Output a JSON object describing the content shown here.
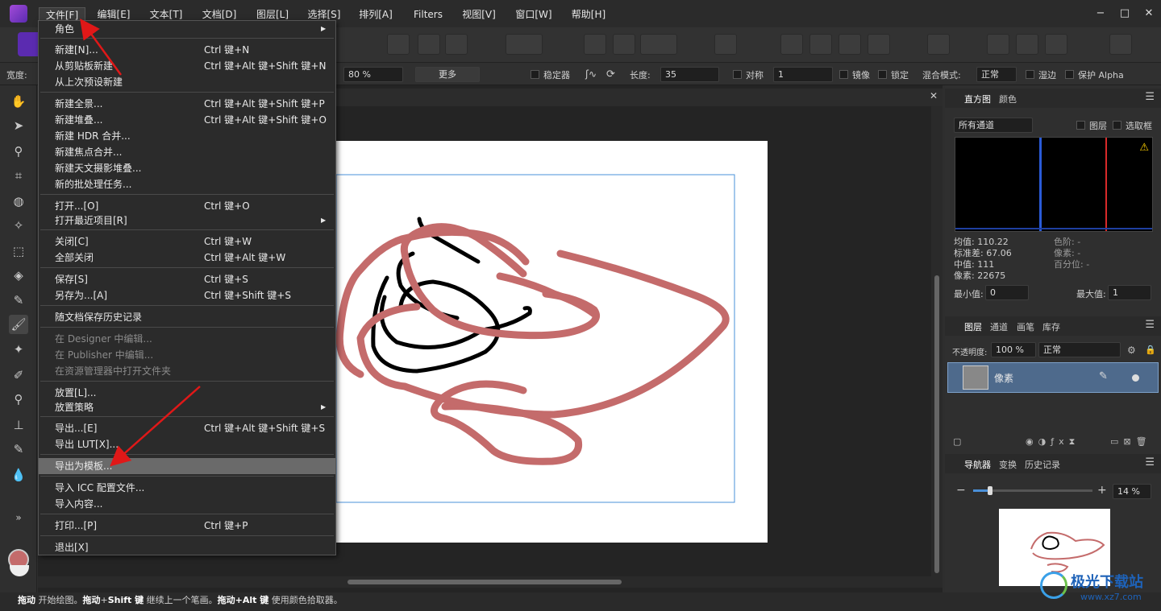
{
  "menubar": {
    "items": [
      "文件[F]",
      "编辑[E]",
      "文本[T]",
      "文档[D]",
      "图层[L]",
      "选择[S]",
      "排列[A]",
      "Filters",
      "视图[V]",
      "窗口[W]",
      "帮助[H]"
    ],
    "window_controls": [
      "minimize",
      "maximize",
      "close"
    ]
  },
  "context_bar": {
    "width_label": "宽度:",
    "opacity_value": "80 %",
    "more_button": "更多",
    "stabilizer_label": "稳定器",
    "length_label": "长度:",
    "length_value": "35",
    "symmetry_label": "对称",
    "symmetry_value": "1",
    "mirror_label": "镜像",
    "lock_label": "锁定",
    "blend_mode_label": "混合模式:",
    "blend_mode_value": "正常",
    "wet_edges_label": "湿边",
    "protect_alpha_label": "保护 Alpha"
  },
  "file_menu": {
    "rows": [
      {
        "label": "角色",
        "shortcut": "",
        "arrow": true,
        "disabled": false
      },
      {
        "label": "新建[N]...",
        "shortcut": "Ctrl 键+N",
        "disabled": false
      },
      {
        "label": "从剪贴板新建",
        "shortcut": "Ctrl 键+Alt 键+Shift 键+N",
        "disabled": false
      },
      {
        "label": "从上次预设新建",
        "shortcut": "",
        "disabled": false
      },
      {
        "label": "新建全景...",
        "shortcut": "Ctrl 键+Alt 键+Shift 键+P",
        "disabled": false
      },
      {
        "label": "新建堆叠...",
        "shortcut": "Ctrl 键+Alt 键+Shift 键+O",
        "disabled": false
      },
      {
        "label": "新建 HDR 合并...",
        "shortcut": "",
        "disabled": false
      },
      {
        "label": "新建焦点合并...",
        "shortcut": "",
        "disabled": false
      },
      {
        "label": "新建天文摄影堆叠...",
        "shortcut": "",
        "disabled": false
      },
      {
        "label": "新的批处理任务...",
        "shortcut": "",
        "disabled": false
      },
      {
        "label": "打开...[O]",
        "shortcut": "Ctrl 键+O",
        "disabled": false
      },
      {
        "label": "打开最近项目[R]",
        "shortcut": "",
        "arrow": true,
        "disabled": false
      },
      {
        "label": "关闭[C]",
        "shortcut": "Ctrl 键+W",
        "disabled": false
      },
      {
        "label": "全部关闭",
        "shortcut": "Ctrl 键+Alt 键+W",
        "disabled": false
      },
      {
        "label": "保存[S]",
        "shortcut": "Ctrl 键+S",
        "disabled": false
      },
      {
        "label": "另存为...[A]",
        "shortcut": "Ctrl 键+Shift 键+S",
        "disabled": false
      },
      {
        "label": "随文档保存历史记录",
        "shortcut": "",
        "disabled": false
      },
      {
        "label": "在 Designer 中编辑...",
        "shortcut": "",
        "disabled": true
      },
      {
        "label": "在 Publisher 中编辑...",
        "shortcut": "",
        "disabled": true
      },
      {
        "label": "在资源管理器中打开文件夹",
        "shortcut": "",
        "disabled": true
      },
      {
        "label": "放置[L]...",
        "shortcut": "",
        "disabled": false
      },
      {
        "label": "放置策略",
        "shortcut": "",
        "arrow": true,
        "disabled": false
      },
      {
        "label": "导出...[E]",
        "shortcut": "Ctrl 键+Alt 键+Shift 键+S",
        "disabled": false
      },
      {
        "label": "导出 LUT[X]...",
        "shortcut": "",
        "disabled": false
      },
      {
        "label": "导出为模板...",
        "shortcut": "",
        "disabled": false,
        "highlighted": true
      },
      {
        "label": "导入 ICC 配置文件...",
        "shortcut": "",
        "disabled": false
      },
      {
        "label": "导入内容...",
        "shortcut": "",
        "disabled": false
      },
      {
        "label": "打印...[P]",
        "shortcut": "Ctrl 键+P",
        "disabled": false
      },
      {
        "label": "退出[X]",
        "shortcut": "",
        "disabled": false
      }
    ]
  },
  "histogram_panel": {
    "tabs": [
      "直方图",
      "颜色"
    ],
    "channel": "所有通道",
    "layer_label": "图层",
    "marquee_label": "选取框",
    "stats_left": [
      "均值: 110.22",
      "标准差: 67.06",
      "中值: 111",
      "像素: 22675"
    ],
    "stats_right": [
      "色阶: -",
      "像素: -",
      "百分位: -"
    ],
    "min_label": "最小值:",
    "min_value": "0",
    "max_label": "最大值:",
    "max_value": "1",
    "warning_icon": "warning-icon"
  },
  "layers_panel": {
    "tabs": [
      "图层",
      "通道",
      "画笔",
      "库存"
    ],
    "opacity_label": "不透明度:",
    "opacity_value": "100 %",
    "blend_value": "正常",
    "layer_name": "像素"
  },
  "navigator_panel": {
    "tabs": [
      "导航器",
      "变换",
      "历史记录"
    ],
    "zoom_value": "14 %",
    "zoom_level": 0.14
  },
  "status": {
    "t1": "拖动",
    "t2": " 开始绘图。",
    "t3": "拖动",
    "t4": "+",
    "t5": "Shift 键",
    "t6": " 继续上一个笔画。",
    "t7": "拖动",
    "t8": "+Alt 键",
    "t9": " 使用颜色拾取器。"
  },
  "watermark": {
    "text1": "极光下载站",
    "text2": "www.xz7.com"
  },
  "colors": {
    "accent": "#5b2bb0",
    "stroke_pink": "#c46b6b",
    "stroke_black": "#000000",
    "annotation_red": "#e01818",
    "layer_selected": "#4e6a8c"
  }
}
